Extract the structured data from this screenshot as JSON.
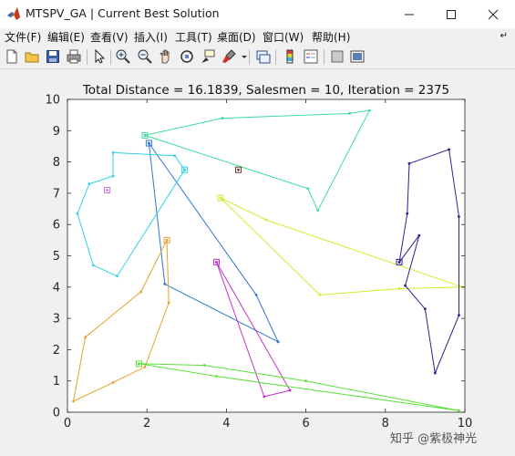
{
  "window": {
    "title": "MTSPV_GA | Current Best Solution",
    "icon": "matlab-icon"
  },
  "menu": {
    "items": [
      "文件(F)",
      "编辑(E)",
      "查看(V)",
      "插入(I)",
      "工具(T)",
      "桌面(D)",
      "窗口(W)",
      "帮助(H)"
    ],
    "overflow_icon": "dock-arrow-icon"
  },
  "toolbar": {
    "icons": [
      "new-figure-icon",
      "open-file-icon",
      "save-icon",
      "print-icon",
      "pointer-icon",
      "zoom-in-icon",
      "zoom-out-icon",
      "pan-icon",
      "rotate-3d-icon",
      "data-cursor-icon",
      "brush-icon",
      "link-icon",
      "colorbar-icon",
      "legend-icon",
      "hide-plot-tools-icon",
      "show-plot-tools-icon"
    ]
  },
  "watermark": "知乎 @紫极神光",
  "chart_data": {
    "type": "line",
    "title": "Total Distance = 16.1839, Salesmen = 10, Iteration = 2375",
    "xlim": [
      0,
      10
    ],
    "ylim": [
      0,
      10
    ],
    "xticks": [
      "0",
      "2",
      "4",
      "6",
      "8",
      "10"
    ],
    "yticks": [
      "0",
      "1",
      "2",
      "3",
      "4",
      "5",
      "6",
      "7",
      "8",
      "9",
      "10"
    ],
    "grid": false,
    "series": [
      {
        "color": "#3fdc9a",
        "depot": [
          1.95,
          8.85
        ],
        "points": [
          [
            1.95,
            8.85
          ],
          [
            3.9,
            9.4
          ],
          [
            7.1,
            9.55
          ],
          [
            7.6,
            9.65
          ],
          [
            6.3,
            6.45
          ],
          [
            6.05,
            7.15
          ],
          [
            1.95,
            8.85
          ]
        ]
      },
      {
        "color": "#2b78d0",
        "depot": [
          2.05,
          8.6
        ],
        "points": [
          [
            2.05,
            8.6
          ],
          [
            4.75,
            3.75
          ],
          [
            5.3,
            2.25
          ],
          [
            2.45,
            4.1
          ],
          [
            2.05,
            8.6
          ]
        ]
      },
      {
        "color": "#2fd3e8",
        "depot": [
          2.95,
          7.75
        ],
        "points": [
          [
            2.95,
            7.75
          ],
          [
            2.7,
            8.2
          ],
          [
            1.15,
            8.3
          ],
          [
            1.15,
            7.55
          ],
          [
            0.55,
            7.3
          ],
          [
            0.25,
            6.35
          ],
          [
            0.65,
            4.7
          ],
          [
            1.25,
            4.35
          ],
          [
            2.95,
            7.75
          ]
        ]
      },
      {
        "color": "#c678d8",
        "depot": [
          1.0,
          7.1
        ],
        "points": [
          [
            1.0,
            7.1
          ]
        ]
      },
      {
        "color": "#6a3b2c",
        "depot": [
          4.3,
          7.75
        ],
        "points": [
          [
            4.3,
            7.75
          ]
        ]
      },
      {
        "color": "#d3ea2e",
        "depot": [
          3.85,
          6.85
        ],
        "points": [
          [
            3.85,
            6.85
          ],
          [
            5.0,
            6.15
          ],
          [
            9.95,
            4.0
          ],
          [
            8.35,
            3.95
          ],
          [
            6.35,
            3.75
          ],
          [
            3.85,
            6.85
          ]
        ]
      },
      {
        "color": "#29228c",
        "depot": [
          8.35,
          4.8
        ],
        "points": [
          [
            8.35,
            4.8
          ],
          [
            8.55,
            6.35
          ],
          [
            8.6,
            7.95
          ],
          [
            9.6,
            8.4
          ],
          [
            9.85,
            6.25
          ],
          [
            9.85,
            3.1
          ],
          [
            9.25,
            1.25
          ],
          [
            9.0,
            3.3
          ],
          [
            8.5,
            4.05
          ],
          [
            8.85,
            5.65
          ],
          [
            8.35,
            4.8
          ]
        ]
      },
      {
        "color": "#e7a12e",
        "depot": [
          2.5,
          5.5
        ],
        "points": [
          [
            2.5,
            5.5
          ],
          [
            1.85,
            3.85
          ],
          [
            0.45,
            2.4
          ],
          [
            0.15,
            0.35
          ],
          [
            1.15,
            0.95
          ],
          [
            1.95,
            1.45
          ],
          [
            2.55,
            3.5
          ],
          [
            2.5,
            5.5
          ]
        ]
      },
      {
        "color": "#c232c8",
        "depot": [
          3.75,
          4.8
        ],
        "points": [
          [
            3.75,
            4.8
          ],
          [
            4.95,
            0.5
          ],
          [
            5.6,
            0.7
          ],
          [
            3.75,
            4.8
          ]
        ]
      },
      {
        "color": "#5be23a",
        "depot": [
          1.8,
          1.55
        ],
        "points": [
          [
            1.8,
            1.55
          ],
          [
            3.45,
            1.5
          ],
          [
            6.0,
            1.0
          ],
          [
            9.85,
            0.05
          ],
          [
            3.75,
            1.15
          ],
          [
            1.8,
            1.55
          ]
        ]
      }
    ]
  }
}
